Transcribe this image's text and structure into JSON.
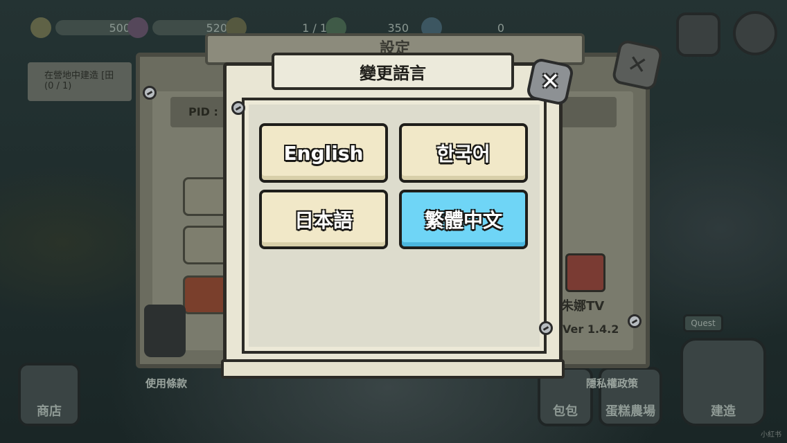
{
  "hud": {
    "gold": "500",
    "gems": "520",
    "population": "1 / 1",
    "leaves": "350",
    "crystals": "0"
  },
  "settings_panel": {
    "title": "設定",
    "pid_label": "PID :",
    "quest_text": "在營地中建造 [田\n(0 / 1)",
    "tv_label": "朱娜TV",
    "version": "Ver 1.4.2",
    "terms_link": "使用條款",
    "privacy_link": "隱私權政策"
  },
  "bottom_bar": {
    "shop": "商店",
    "bag": "包包",
    "farm": "蛋糕農場",
    "build": "建造",
    "quest": "Quest"
  },
  "language_dialog": {
    "title": "變更語言",
    "options": [
      {
        "label": "English",
        "selected": false
      },
      {
        "label": "한국어",
        "selected": false
      },
      {
        "label": "日本語",
        "selected": false
      },
      {
        "label": "繁體中文",
        "selected": true
      }
    ],
    "close_icon": "close-x-icon"
  },
  "watermark": "小紅书",
  "colors": {
    "selected_button": "#6fd5f6",
    "default_button": "#f1e8c8",
    "dialog_bg": "#e9e6d4"
  }
}
